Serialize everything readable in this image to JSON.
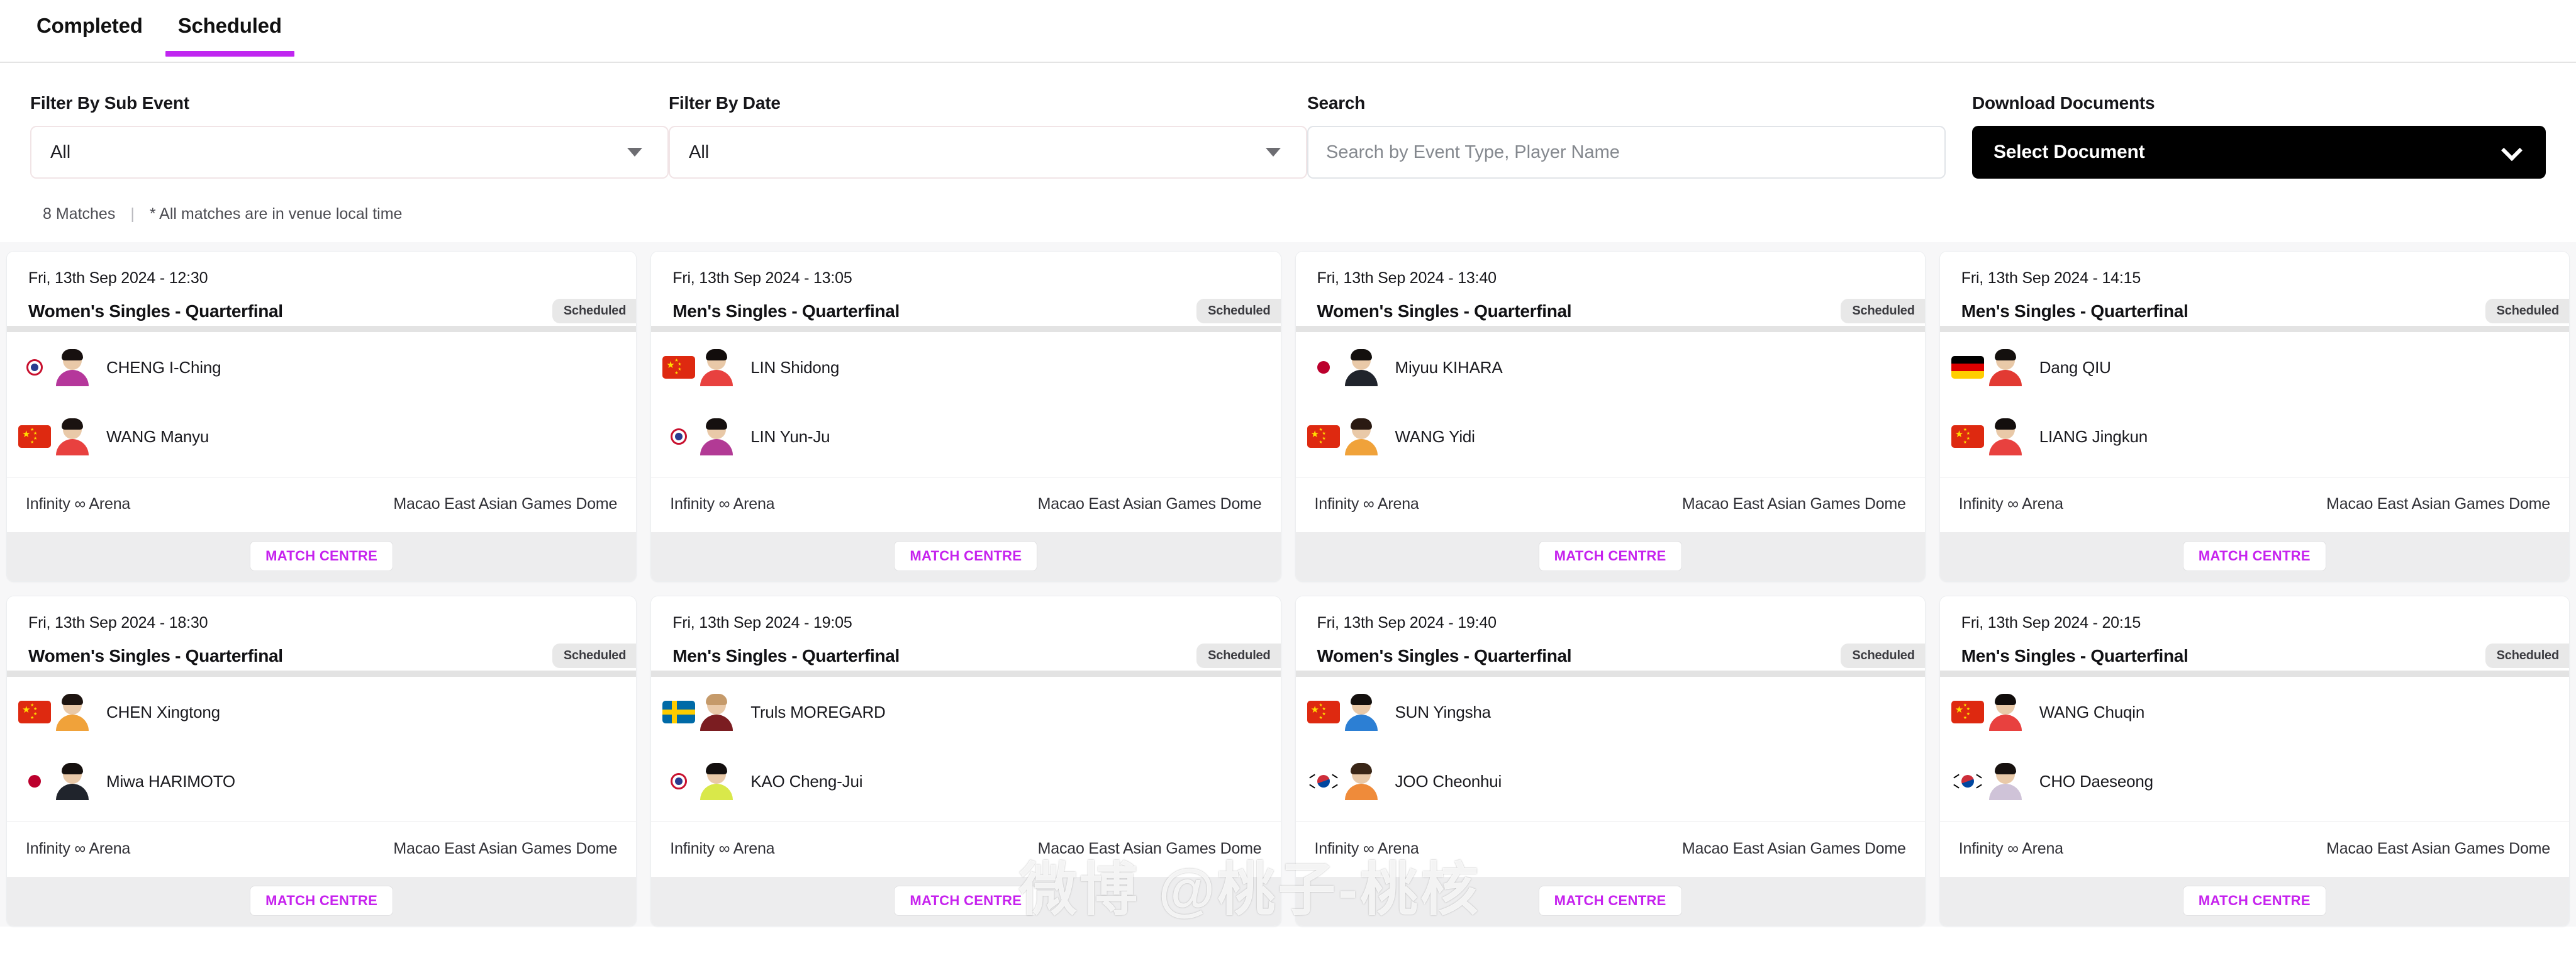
{
  "tabs": [
    {
      "label": "Completed",
      "active": false
    },
    {
      "label": "Scheduled",
      "active": true
    }
  ],
  "filters": {
    "sub_event": {
      "label": "Filter By Sub Event",
      "value": "All"
    },
    "date": {
      "label": "Filter By Date",
      "value": "All"
    },
    "search": {
      "label": "Search",
      "placeholder": "Search by Event Type, Player Name",
      "value": ""
    },
    "documents": {
      "label": "Download Documents",
      "value": "Select Document"
    }
  },
  "summary": {
    "match_count": "8 Matches",
    "separator": "|",
    "note": "* All matches are in venue local time"
  },
  "card_common": {
    "match_centre_label": "MATCH CENTRE",
    "status_label": "Scheduled",
    "arena": "Infinity ∞ Arena",
    "venue": "Macao East Asian Games Dome"
  },
  "accent": {
    "tab_underline": "#c026f0",
    "match_centre": "#c622ee",
    "doc_button_bg": "#000000"
  },
  "watermark": "微博 @桃子-桃核",
  "matches": [
    {
      "datetime": "Fri, 13th Sep 2024 - 12:30",
      "title": "Women's Singles - Quarterfinal",
      "status": "Scheduled",
      "arena": "Infinity ∞ Arena",
      "venue": "Macao East Asian Games Dome",
      "players": [
        {
          "name": "CHENG I-Ching",
          "flag": "tpe",
          "kit": "#b5379b",
          "hair": "#17100f"
        },
        {
          "name": "WANG Manyu",
          "flag": "cn",
          "kit": "#e8413f",
          "hair": "#1a1210"
        }
      ]
    },
    {
      "datetime": "Fri, 13th Sep 2024 - 13:05",
      "title": "Men's Singles - Quarterfinal",
      "status": "Scheduled",
      "arena": "Infinity ∞ Arena",
      "venue": "Macao East Asian Games Dome",
      "players": [
        {
          "name": "LIN Shidong",
          "flag": "cn",
          "kit": "#e8413f",
          "hair": "#120d0c"
        },
        {
          "name": "LIN Yun-Ju",
          "flag": "tpe",
          "kit": "#b23a95",
          "hair": "#15100f"
        }
      ]
    },
    {
      "datetime": "Fri, 13th Sep 2024 - 13:40",
      "title": "Women's Singles - Quarterfinal",
      "status": "Scheduled",
      "arena": "Infinity ∞ Arena",
      "venue": "Macao East Asian Games Dome",
      "players": [
        {
          "name": "Miyuu KIHARA",
          "flag": "jp",
          "kit": "#20242c",
          "hair": "#14100e"
        },
        {
          "name": "WANG Yidi",
          "flag": "cn",
          "kit": "#f0a23a",
          "hair": "#2a1a12"
        }
      ]
    },
    {
      "datetime": "Fri, 13th Sep 2024 - 14:15",
      "title": "Men's Singles - Quarterfinal",
      "status": "Scheduled",
      "arena": "Infinity ∞ Arena",
      "venue": "Macao East Asian Games Dome",
      "players": [
        {
          "name": "Dang QIU",
          "flag": "de",
          "kit": "#e23a33",
          "hair": "#14100e"
        },
        {
          "name": "LIANG Jingkun",
          "flag": "cn",
          "kit": "#e8413f",
          "hair": "#130e0d"
        }
      ]
    },
    {
      "datetime": "Fri, 13th Sep 2024 - 18:30",
      "title": "Women's Singles - Quarterfinal",
      "status": "Scheduled",
      "arena": "Infinity ∞ Arena",
      "venue": "Macao East Asian Games Dome",
      "players": [
        {
          "name": "CHEN Xingtong",
          "flag": "cn",
          "kit": "#f0a23a",
          "hair": "#1d1410"
        },
        {
          "name": "Miwa HARIMOTO",
          "flag": "jp",
          "kit": "#20242c",
          "hair": "#16110f"
        }
      ]
    },
    {
      "datetime": "Fri, 13th Sep 2024 - 19:05",
      "title": "Men's Singles - Quarterfinal",
      "status": "Scheduled",
      "arena": "Infinity ∞ Arena",
      "venue": "Macao East Asian Games Dome",
      "players": [
        {
          "name": "Truls MOREGARD",
          "flag": "se",
          "kit": "#7b1d21",
          "hair": "#c59a6a"
        },
        {
          "name": "KAO Cheng-Jui",
          "flag": "tpe",
          "kit": "#d9e84a",
          "hair": "#130f0e"
        }
      ]
    },
    {
      "datetime": "Fri, 13th Sep 2024 - 19:40",
      "title": "Women's Singles - Quarterfinal",
      "status": "Scheduled",
      "arena": "Infinity ∞ Arena",
      "venue": "Macao East Asian Games Dome",
      "players": [
        {
          "name": "SUN Yingsha",
          "flag": "cn",
          "kit": "#2c7fd4",
          "hair": "#14100e"
        },
        {
          "name": "JOO Cheonhui",
          "flag": "kr",
          "kit": "#ef8b3a",
          "hair": "#3a2617"
        }
      ]
    },
    {
      "datetime": "Fri, 13th Sep 2024 - 20:15",
      "title": "Men's Singles - Quarterfinal",
      "status": "Scheduled",
      "arena": "Infinity ∞ Arena",
      "venue": "Macao East Asian Games Dome",
      "players": [
        {
          "name": "WANG Chuqin",
          "flag": "cn",
          "kit": "#e8413f",
          "hair": "#110d0c"
        },
        {
          "name": "CHO Daeseong",
          "flag": "kr",
          "kit": "#cfc3d8",
          "hair": "#17110f"
        }
      ]
    }
  ]
}
